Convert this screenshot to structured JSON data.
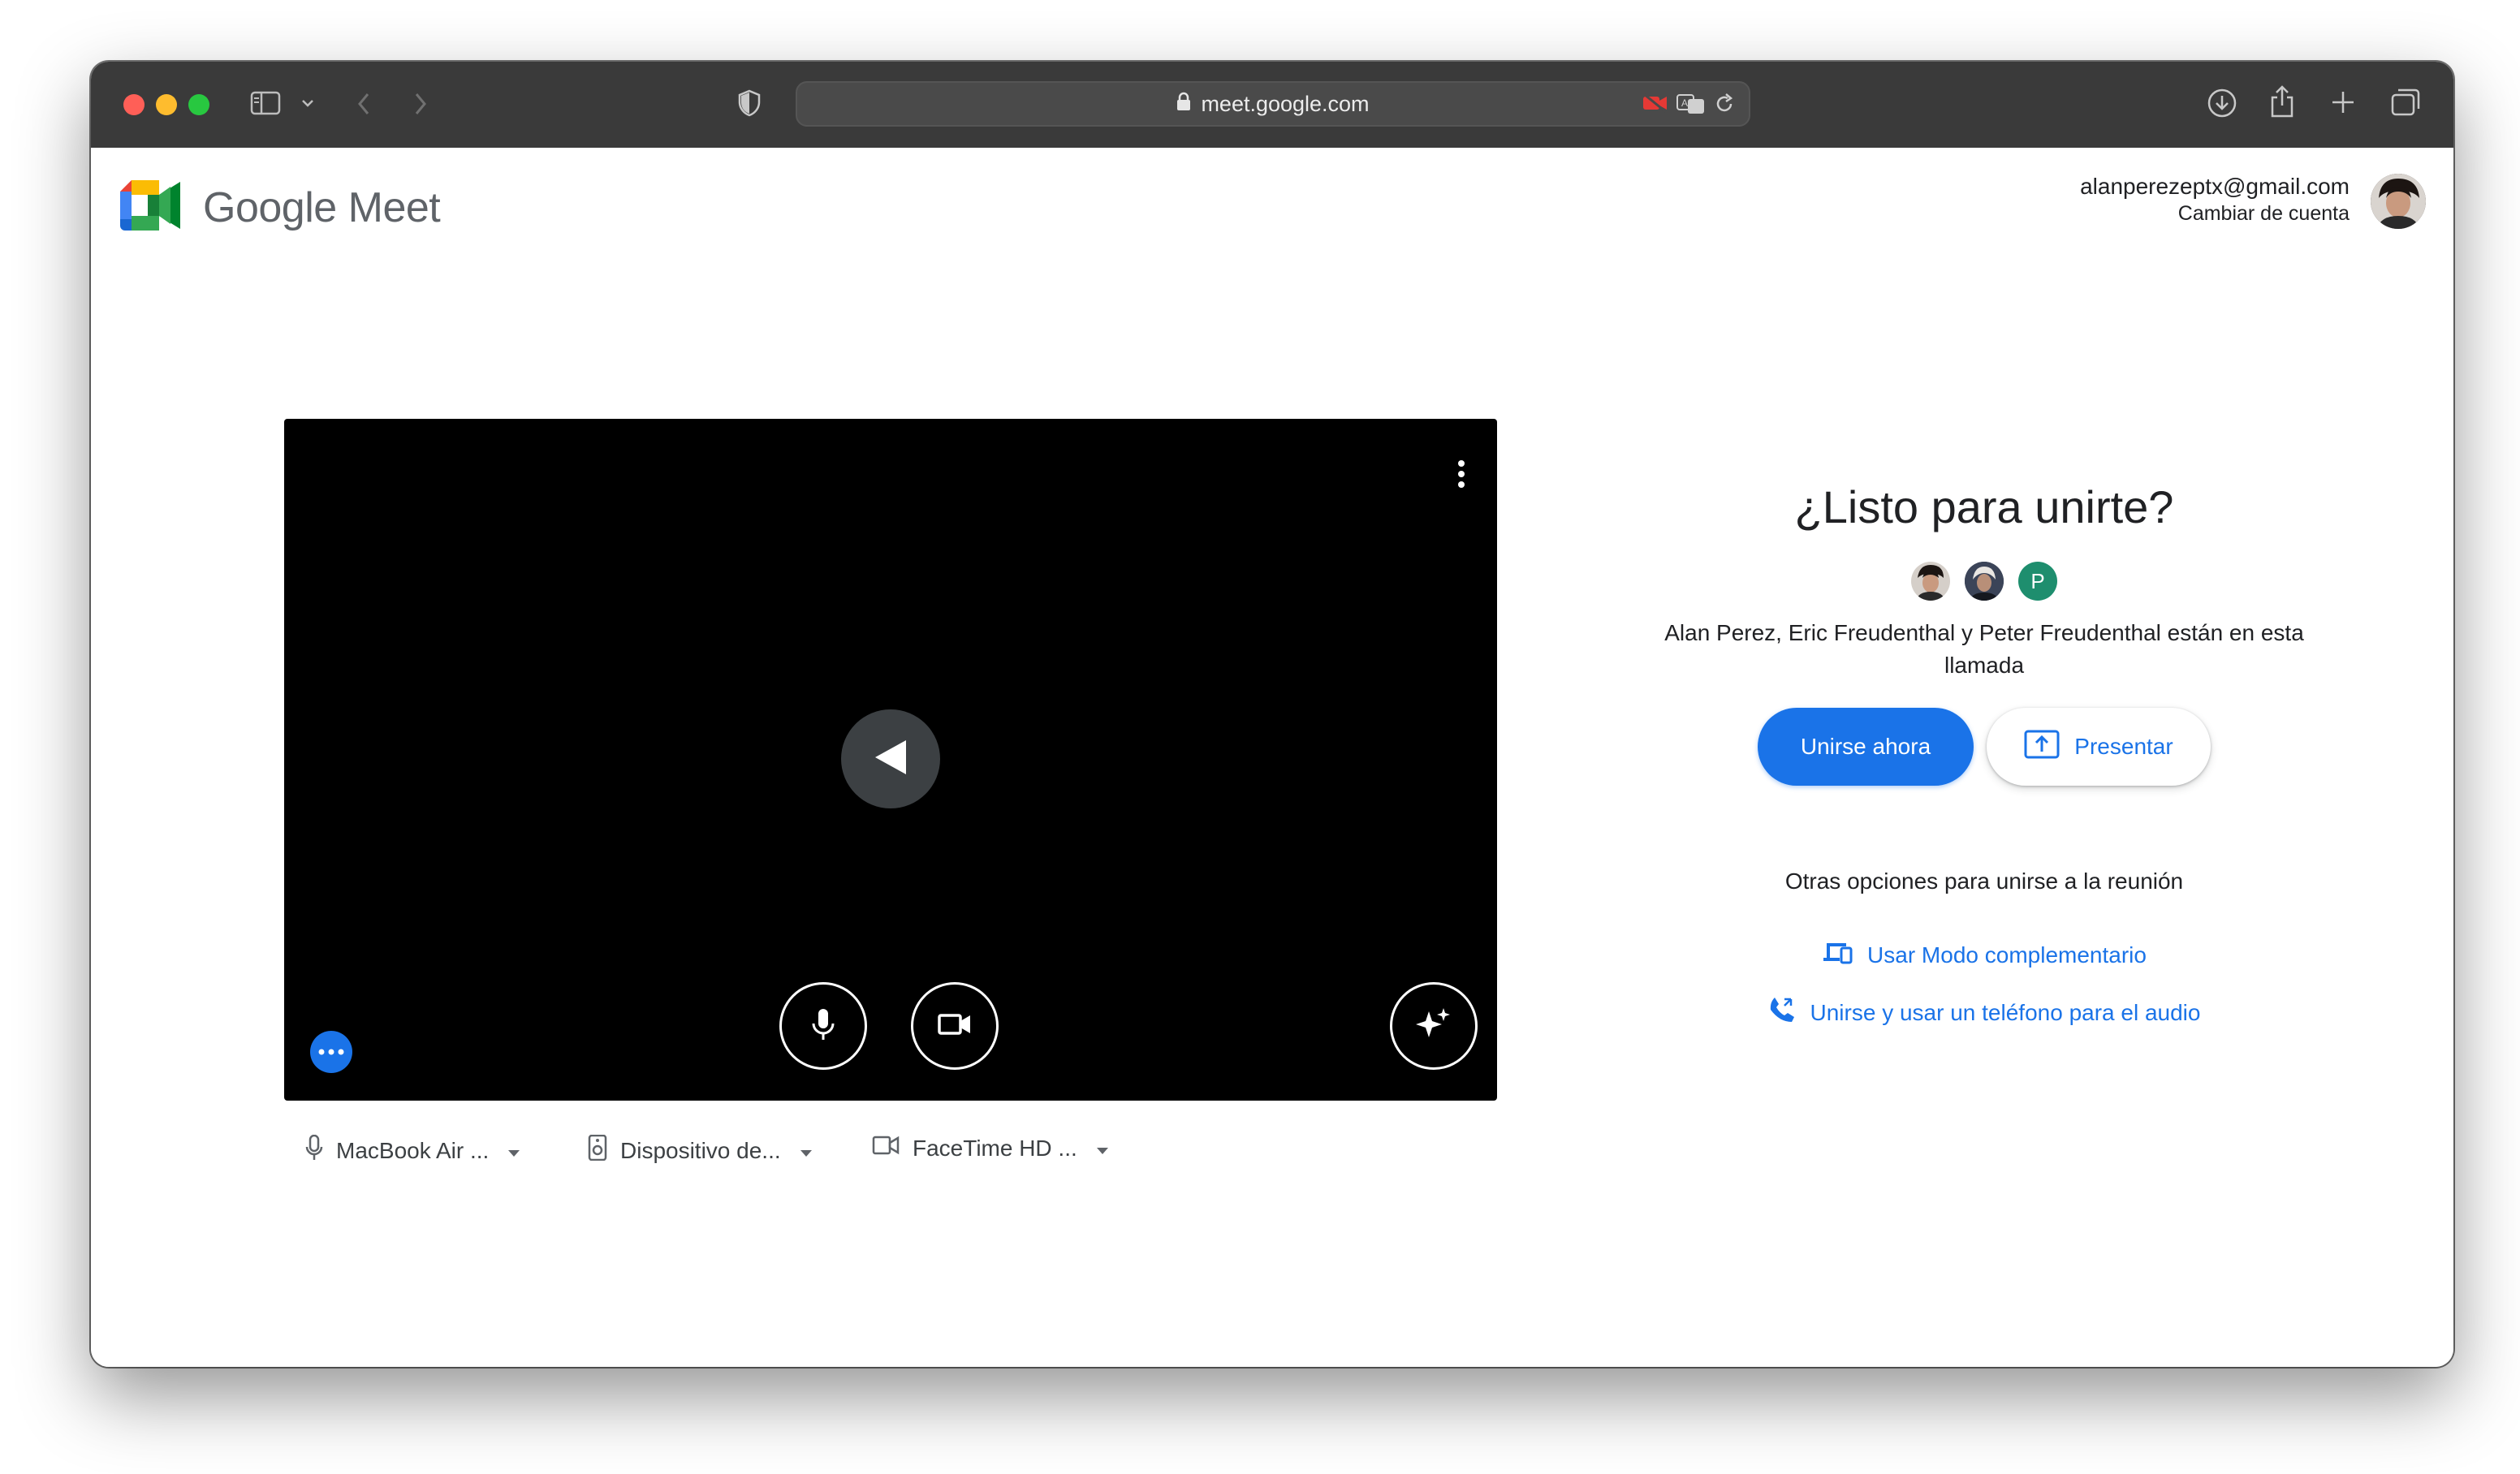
{
  "browser": {
    "url": "meet.google.com"
  },
  "header": {
    "logo_text": "Google Meet",
    "account_email": "alanperezeptx@gmail.com",
    "switch_account": "Cambiar de cuenta"
  },
  "preview": {
    "devices": [
      {
        "icon": "microphone-icon",
        "label": "MacBook Air ..."
      },
      {
        "icon": "speaker-icon",
        "label": "Dispositivo de..."
      },
      {
        "icon": "camera-icon",
        "label": "FaceTime HD ..."
      }
    ]
  },
  "join": {
    "title": "¿Listo para unirte?",
    "participant_letter": "P",
    "participants_text": "Alan Perez, Eric Freudenthal y Peter Freudenthal están en esta llamada",
    "join_button": "Unirse ahora",
    "present_button": "Presentar",
    "other_options_title": "Otras opciones para unirse a la reunión",
    "companion_mode": "Usar Modo complementario",
    "phone_audio": "Unirse y usar un teléfono para el audio"
  },
  "colors": {
    "accent": "#1a73e8",
    "titlebar": "#3a3a3a",
    "video_bg": "#000000"
  }
}
